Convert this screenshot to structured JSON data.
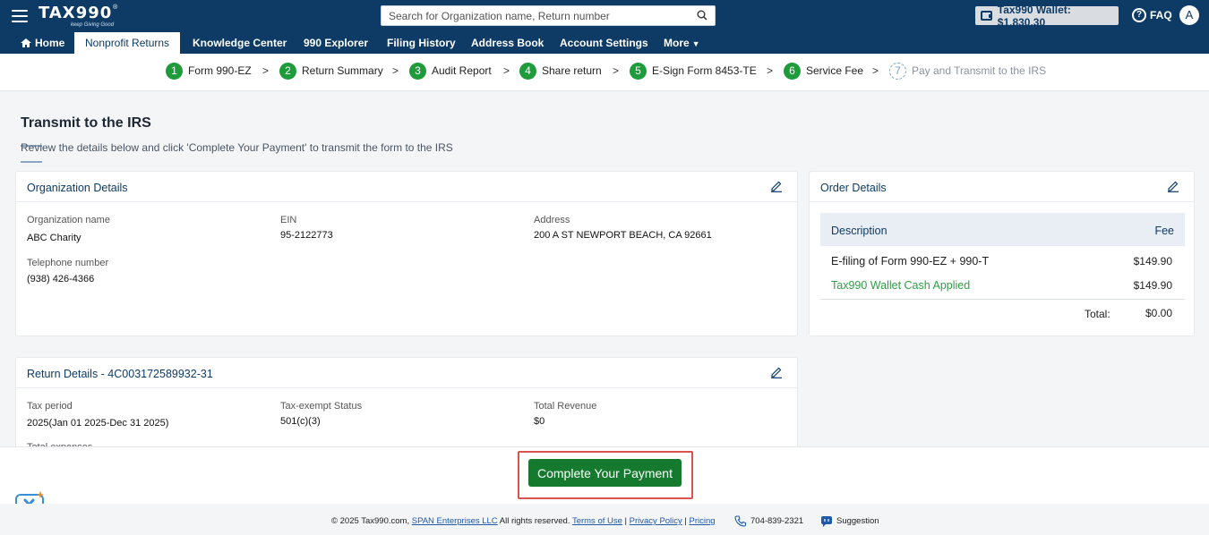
{
  "header": {
    "logo": "TAX990",
    "logo_tagline": "keep Giving Good",
    "search_placeholder": "Search for Organization name, Return number",
    "wallet_label": "Tax990 Wallet: $1,830.30",
    "faq_label": "FAQ",
    "avatar_initial": "A"
  },
  "nav": {
    "items": [
      {
        "label": "Home"
      },
      {
        "label": "Nonprofit Returns"
      },
      {
        "label": "Knowledge Center"
      },
      {
        "label": "990 Explorer"
      },
      {
        "label": "Filing History"
      },
      {
        "label": "Address Book"
      },
      {
        "label": "Account Settings"
      },
      {
        "label": "More"
      }
    ]
  },
  "stepper": {
    "steps": [
      {
        "num": "1",
        "label": "Form 990-EZ",
        "status": "complete"
      },
      {
        "num": "2",
        "label": "Return Summary",
        "status": "complete"
      },
      {
        "num": "3",
        "label": "Audit Report",
        "status": "complete"
      },
      {
        "num": "4",
        "label": "Share return",
        "status": "complete"
      },
      {
        "num": "5",
        "label": "E-Sign Form 8453-TE",
        "status": "complete"
      },
      {
        "num": "6",
        "label": "Service Fee",
        "status": "complete"
      },
      {
        "num": "7",
        "label": "Pay and Transmit to the IRS",
        "status": "pending"
      }
    ]
  },
  "page": {
    "title": "Transmit to the IRS",
    "subtitle": "Review the details below and click 'Complete Your Payment' to transmit the form to the IRS"
  },
  "org_details": {
    "title": "Organization Details",
    "org_name_label": "Organization name",
    "org_name": "ABC Charity",
    "ein_label": "EIN",
    "ein": "95-2122773",
    "address_label": "Address",
    "address": "200 A ST NEWPORT BEACH, CA 92661",
    "phone_label": "Telephone number",
    "phone": "(938) 426-4366"
  },
  "order_details": {
    "title": "Order Details",
    "col_description": "Description",
    "col_fee": "Fee",
    "rows": [
      {
        "description": "E-filing of Form 990-EZ + 990-T",
        "fee": "$149.90"
      },
      {
        "description": "Tax990 Wallet Cash Applied",
        "fee": "$149.90"
      }
    ],
    "total_label": "Total:",
    "total": "$0.00"
  },
  "return_details": {
    "title": "Return Details - 4C003172589932-31",
    "tax_period_label": "Tax period",
    "tax_period": "2025(Jan 01 2025-Dec 31 2025)",
    "status_label": "Tax-exempt Status",
    "status": "501(c)(3)",
    "revenue_label": "Total Revenue",
    "revenue": "$0",
    "expenses_label": "Total expenses"
  },
  "action": {
    "pay_button": "Complete Your Payment"
  },
  "footer": {
    "copyright": "© 2025 Tax990.com,",
    "company_link": "SPAN Enterprises LLC",
    "rights": "All rights reserved.",
    "terms": "Terms of Use",
    "privacy": "Privacy Policy",
    "pricing": "Pricing",
    "phone": "704-839-2321",
    "suggestion": "Suggestion"
  },
  "colors": {
    "brand_navy": "#0d3b66",
    "step_green": "#1e9b3a",
    "button_green": "#157a2e",
    "highlight_red": "#d9534f"
  }
}
